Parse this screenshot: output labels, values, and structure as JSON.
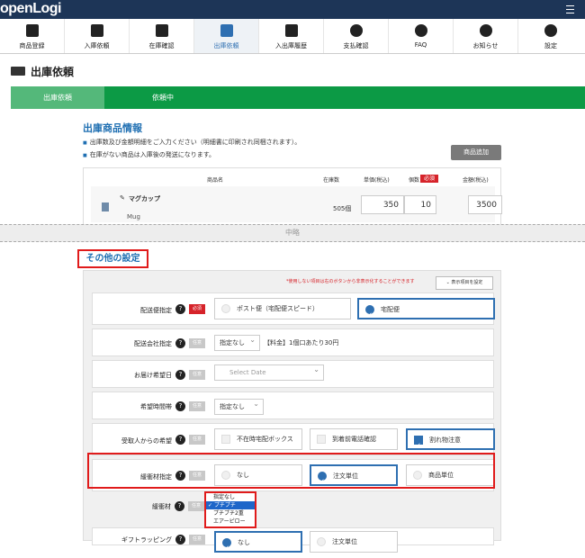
{
  "app": {
    "logo": "openLogi"
  },
  "nav": [
    {
      "label": "商品登録",
      "icon": "product-register-icon"
    },
    {
      "label": "入庫依頼",
      "icon": "inbound-request-icon"
    },
    {
      "label": "在庫確認",
      "icon": "stock-check-icon"
    },
    {
      "label": "出庫依頼",
      "icon": "truck-icon"
    },
    {
      "label": "入出庫履歴",
      "icon": "history-icon"
    },
    {
      "label": "支払確認",
      "icon": "yen-icon"
    },
    {
      "label": "FAQ",
      "icon": "question-icon"
    },
    {
      "label": "お知らせ",
      "icon": "bell-icon"
    },
    {
      "label": "設定",
      "icon": "gear-icon"
    }
  ],
  "page": {
    "title": "出庫依頼"
  },
  "steps": {
    "step1": "出庫依頼",
    "step2": "依頼中"
  },
  "product_section": {
    "title": "出庫商品情報",
    "bullet1": "出庫数及び金額明細をご入力ください（明細書に印刷され同梱されます）。",
    "bullet2": "在庫がない商品は入庫後の発送になります。",
    "add_button": "商品追加",
    "headers": {
      "name": "商品名",
      "stock": "在庫数",
      "price": "単価(税込)",
      "qty": "個数",
      "required": "必須",
      "amount": "金額(税込)"
    },
    "row": {
      "name": "マグカップ",
      "name_en": "Mug",
      "stock": "505個",
      "price": "350",
      "qty": "10",
      "amount": "3500"
    }
  },
  "omit_label": "中略",
  "other": {
    "title": "その他の設定",
    "note": "*使用しない項目は右のボタンから非表示化することができます",
    "edit_button": "⌄ 表示項目を設定",
    "tag_required": "必須",
    "tag_optional": "任意",
    "delivery": {
      "label": "配送便指定",
      "opt1": "ポスト便（宅配便スピード）",
      "opt2": "宅配便"
    },
    "company": {
      "label": "配送会社指定",
      "select": "指定なし",
      "fee": "【料金】1個口あたり30円"
    },
    "date": {
      "label": "お届け希望日",
      "placeholder": "Select Date"
    },
    "time": {
      "label": "希望時間帯",
      "select": "指定なし"
    },
    "recipient": {
      "label": "受取人からの希望",
      "opt1": "不在時宅配ボックス",
      "opt2": "到着前電話確認",
      "opt3": "割れ物注意"
    },
    "cushion": {
      "label": "緩衝材指定",
      "opt1": "なし",
      "opt2": "注文単位",
      "opt3": "商品単位"
    },
    "material": {
      "label": "緩衝材",
      "options": [
        "指定なし",
        "✓ プチプチ",
        "プチプチ2重",
        "エアーピロー"
      ]
    },
    "gift": {
      "label": "ギフトラッピング",
      "opt1": "なし",
      "opt2": "注文単位"
    }
  }
}
